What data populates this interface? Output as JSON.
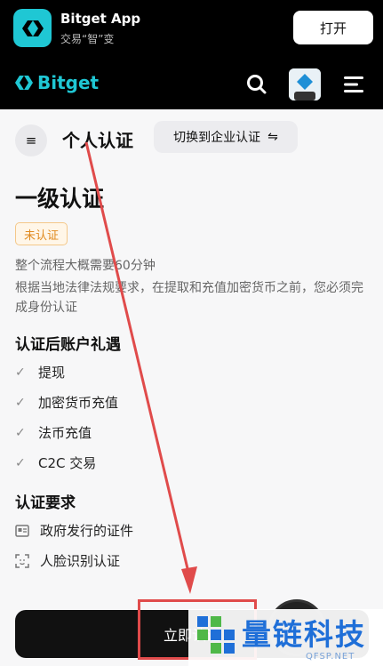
{
  "banner": {
    "app_name": "Bitget App",
    "subtitle": "交易“智”变",
    "open_label": "打开",
    "icon_color": "#1fc7d4"
  },
  "header": {
    "logo_text": "Bitget",
    "accent": "#1fc7d4",
    "icons": [
      "search-icon",
      "avatar",
      "menu-icon"
    ]
  },
  "page": {
    "side_toggle": "≡",
    "title": "个人认证",
    "switch_label": "切换到企业认证",
    "switch_icon": "⇋"
  },
  "verification": {
    "level_title": "一级认证",
    "status": "未认证",
    "duration": "整个流程大概需要60分钟",
    "description": "根据当地法律法规要求，在提取和充值加密货币之前，您必须完成身份认证",
    "benefits_title": "认证后账户礼遇",
    "benefits": [
      "提现",
      "加密货币充值",
      "法币充值",
      "C2C 交易"
    ],
    "requirements_title": "认证要求",
    "requirements": [
      {
        "icon": "id-card-icon",
        "label": "政府发行的证件"
      },
      {
        "icon": "face-scan-icon",
        "label": "人脸识别认证"
      }
    ],
    "start_label": "立即认证"
  },
  "annotation": {
    "color": "#e04b4b"
  },
  "watermark": {
    "text": "量链科技",
    "sub": "QFSP.NET",
    "color": "#1f6fd8"
  }
}
